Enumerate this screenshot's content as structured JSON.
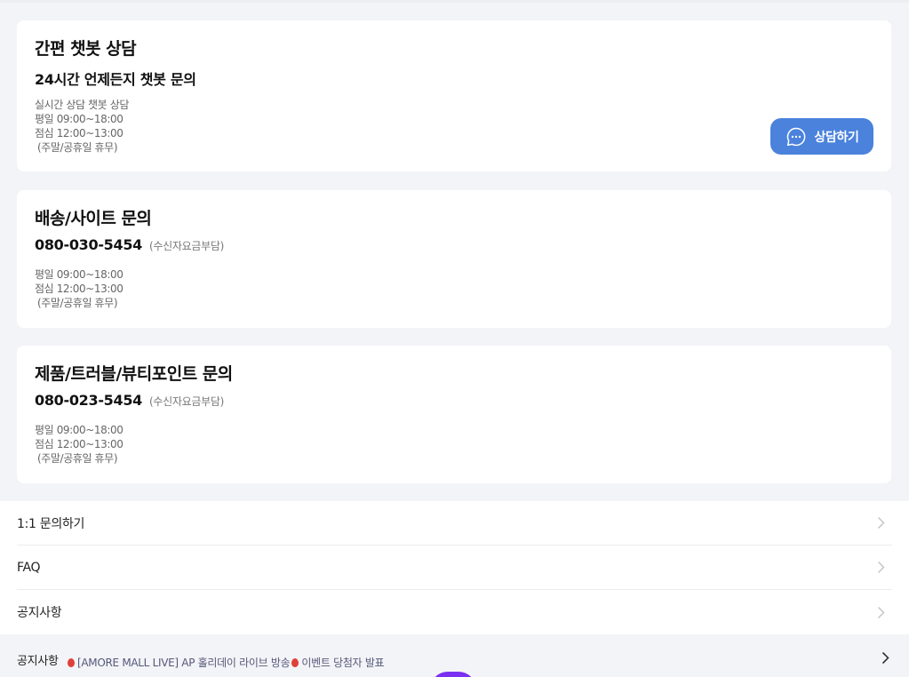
{
  "chat_card": {
    "title": "간편 챗봇 상담",
    "subtitle": "24시간 언제든지 챗봇 문의",
    "hours_line1": "실시간 상담 챗봇 상담",
    "hours_line2": "평일 09:00~18:00",
    "hours_line3": "점심 12:00~13:00",
    "hours_line4": "(주말/공휴일 휴무)",
    "button_label": "상담하기",
    "button_icon": "chat-bubble-icon",
    "button_color": "#4a82dc"
  },
  "delivery_card": {
    "title": "배송/사이트 문의",
    "phone": "080-030-5454",
    "phone_note": "(수신자요금부담)",
    "hours_line1": "평일 09:00~18:00",
    "hours_line2": "점심 12:00~13:00",
    "hours_line3": "(주말/공휴일 휴무)"
  },
  "product_card": {
    "title": "제품/트러블/뷰티포인트 문의",
    "phone": "080-023-5454",
    "phone_note": "(수신자요금부담)",
    "hours_line1": "평일 09:00~18:00",
    "hours_line2": "점심 12:00~13:00",
    "hours_line3": "(주말/공휴일 휴무)"
  },
  "menu": {
    "items": [
      {
        "label": "1:1 문의하기"
      },
      {
        "label": "FAQ"
      },
      {
        "label": "공지사항"
      }
    ]
  },
  "notice_bar": {
    "label": "공지사항",
    "text_part1": "[AMORE MALL LIVE] AP 홀리데이 라이브 방송",
    "text_part2": "이벤트 당첨자 발표"
  },
  "colors": {
    "page_background": "#f3f4f7",
    "accent_purple": "#7b2ff0"
  }
}
